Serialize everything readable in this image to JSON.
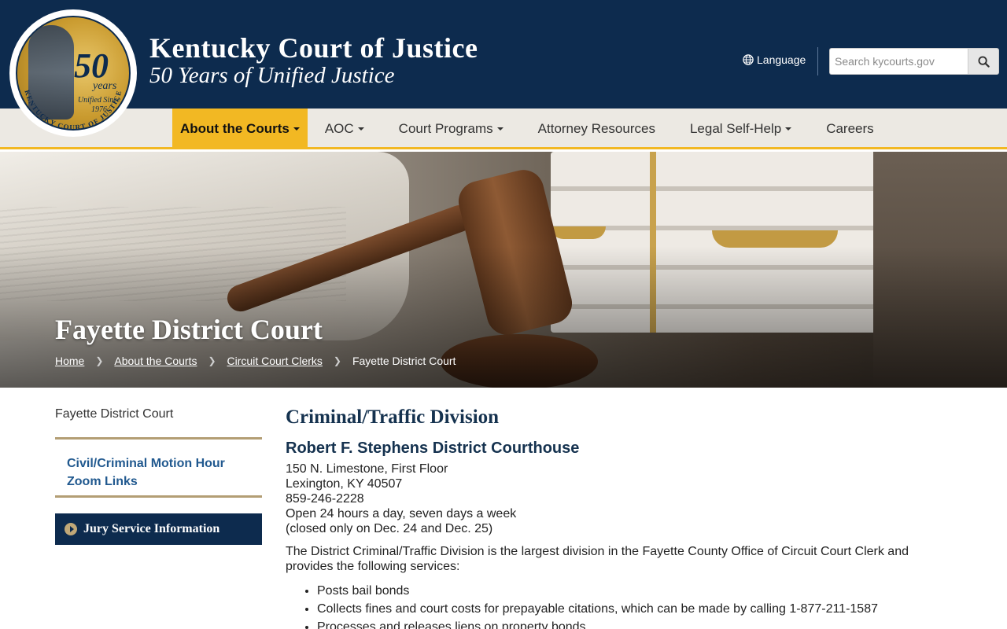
{
  "header": {
    "title": "Kentucky Court of Justice",
    "subtitle": "50 Years of Unified Justice",
    "seal": {
      "number": "50",
      "years": "years",
      "since": "Unified Since 1976",
      "ring_text": "KENTUCKY COURT OF JUSTICE"
    },
    "language_label": "Language",
    "search_placeholder": "Search kycourts.gov"
  },
  "nav": {
    "items": [
      {
        "label": "About the Courts",
        "dropdown": true,
        "active": true
      },
      {
        "label": "AOC",
        "dropdown": true
      },
      {
        "label": "Court Programs",
        "dropdown": true
      },
      {
        "label": "Attorney Resources",
        "dropdown": false
      },
      {
        "label": "Legal Self-Help",
        "dropdown": true
      },
      {
        "label": "Careers",
        "dropdown": false
      }
    ]
  },
  "hero": {
    "title": "Fayette District Court",
    "breadcrumb": [
      "Home",
      "About the Courts",
      "Circuit Court Clerks",
      "Fayette District Court"
    ]
  },
  "sidebar": {
    "image_alt": "Fayette District Court",
    "link": "Civil/Criminal Motion Hour Zoom Links",
    "jury_button": "Jury Service Information"
  },
  "main": {
    "heading": "Criminal/Traffic Division",
    "courthouse": "Robert F. Stephens District Courthouse",
    "address_lines": [
      "150 N. Limestone, First Floor",
      "Lexington, KY 40507",
      "859-246-2228",
      "Open 24 hours a day, seven days a week",
      "(closed only on Dec. 24 and Dec. 25)"
    ],
    "intro": "The District Criminal/Traffic Division is the largest division in the Fayette County Office of Circuit Court Clerk and provides the following services:",
    "services": [
      "Posts bail bonds",
      "Collects fines and court costs for prepayable citations, which can be made by calling 1-877-211-1587",
      "Processes and releases liens on property bonds"
    ]
  },
  "colors": {
    "header_bg": "#0d2b4e",
    "nav_bg": "#ece9e3",
    "accent_gold": "#f2b823",
    "link_blue": "#21598f"
  }
}
